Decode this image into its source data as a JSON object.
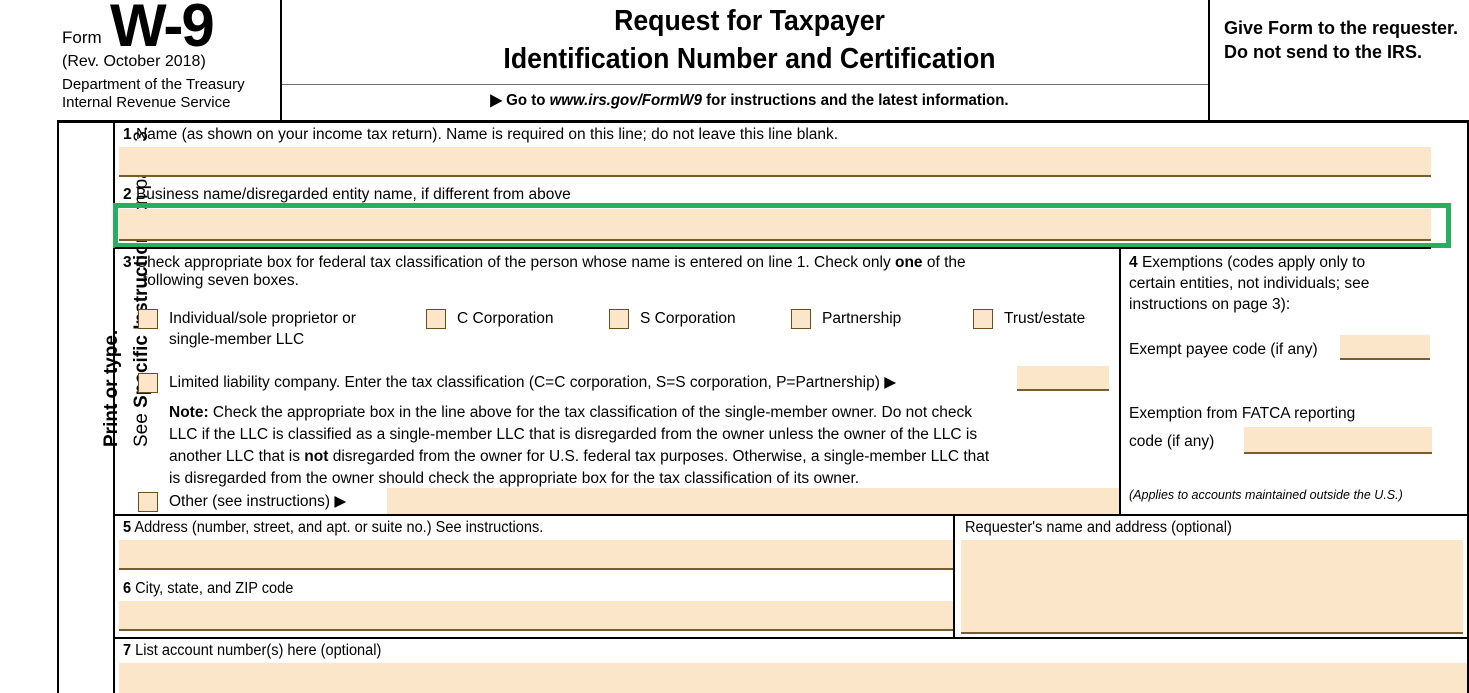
{
  "header": {
    "form_word": "Form",
    "form_number": "W-9",
    "revision": "(Rev. October 2018)",
    "department_line1": "Department of the Treasury",
    "department_line2": "Internal Revenue Service",
    "title_line1": "Request for Taxpayer",
    "title_line2": "Identification Number and Certification",
    "goto_prefix": "Go to ",
    "goto_url": "www.irs.gov/FormW9",
    "goto_suffix": " for instructions and the latest information.",
    "goto_arrow": "▶",
    "give_form_notice": "Give Form to the requester. Do not send to the IRS."
  },
  "sidebar": {
    "print_or_type": "Print or type.",
    "see_prefix": "See ",
    "see_bold": "Specific Instructions",
    "see_suffix": " on page 3."
  },
  "lines": {
    "line1": {
      "number": "1",
      "label": "Name (as shown on your income tax return). Name is required on this line; do not leave this line blank.",
      "value": ""
    },
    "line2": {
      "number": "2",
      "label": "Business name/disregarded entity name, if different from above",
      "value": "",
      "highlighted": true
    },
    "line3": {
      "number": "3",
      "label_part1": "Check appropriate box for federal tax classification of the person whose name is entered on line 1. Check only ",
      "label_bold": "one",
      "label_part2": " of the",
      "label_line2": "following seven boxes.",
      "checkboxes": [
        {
          "id": "individual",
          "label_line1": "Individual/sole proprietor or",
          "label_line2": "single-member LLC",
          "checked": false
        },
        {
          "id": "c-corporation",
          "label_line1": "C Corporation",
          "label_line2": "",
          "checked": false
        },
        {
          "id": "s-corporation",
          "label_line1": "S Corporation",
          "label_line2": "",
          "checked": false
        },
        {
          "id": "partnership",
          "label_line1": "Partnership",
          "label_line2": "",
          "checked": false
        },
        {
          "id": "trust-estate",
          "label_line1": "Trust/estate",
          "label_line2": "",
          "checked": false
        }
      ],
      "llc": {
        "label": "Limited liability company. Enter the tax classification (C=C corporation, S=S corporation, P=Partnership) ▶",
        "value": "",
        "checked": false
      },
      "note": {
        "bold": "Note:",
        "line1": " Check the appropriate box in the line above for the tax classification of the single-member owner.  Do not check",
        "line2": "LLC if the LLC is classified as a single-member LLC that is disregarded from the owner unless the owner of the LLC is",
        "line3_a": "another LLC that is ",
        "line3_bold": "not",
        "line3_b": " disregarded from the owner for U.S. federal tax purposes. Otherwise, a single-member LLC that",
        "line4": "is disregarded from the owner should check the appropriate box for the tax classification of its owner."
      },
      "other": {
        "label": "Other (see instructions) ▶",
        "value": "",
        "checked": false
      }
    },
    "line4": {
      "number": "4",
      "label_line1": "Exemptions (codes apply only to",
      "label_line2": "certain entities, not individuals; see",
      "label_line3": "instructions on page 3):",
      "exempt_payee_label": "Exempt payee code (if any)",
      "exempt_payee_value": "",
      "fatca_label_line1": "Exemption from FATCA reporting",
      "fatca_label_line2": "code (if any)",
      "fatca_value": "",
      "applies_note": "(Applies to accounts maintained outside the U.S.)"
    },
    "line5": {
      "number": "5",
      "label": "Address (number, street, and apt. or suite no.) See instructions.",
      "value": ""
    },
    "line6": {
      "number": "6",
      "label": "City, state, and ZIP code",
      "value": ""
    },
    "line7": {
      "number": "7",
      "label": "List account number(s) here (optional)",
      "value": ""
    },
    "requester": {
      "label": "Requester's name and address (optional)",
      "value": ""
    }
  },
  "colors": {
    "field_fill": "#FCE6CA",
    "field_underline": "#7a5c2e",
    "highlight_green": "#27AE5E",
    "rule_black": "#000000"
  }
}
